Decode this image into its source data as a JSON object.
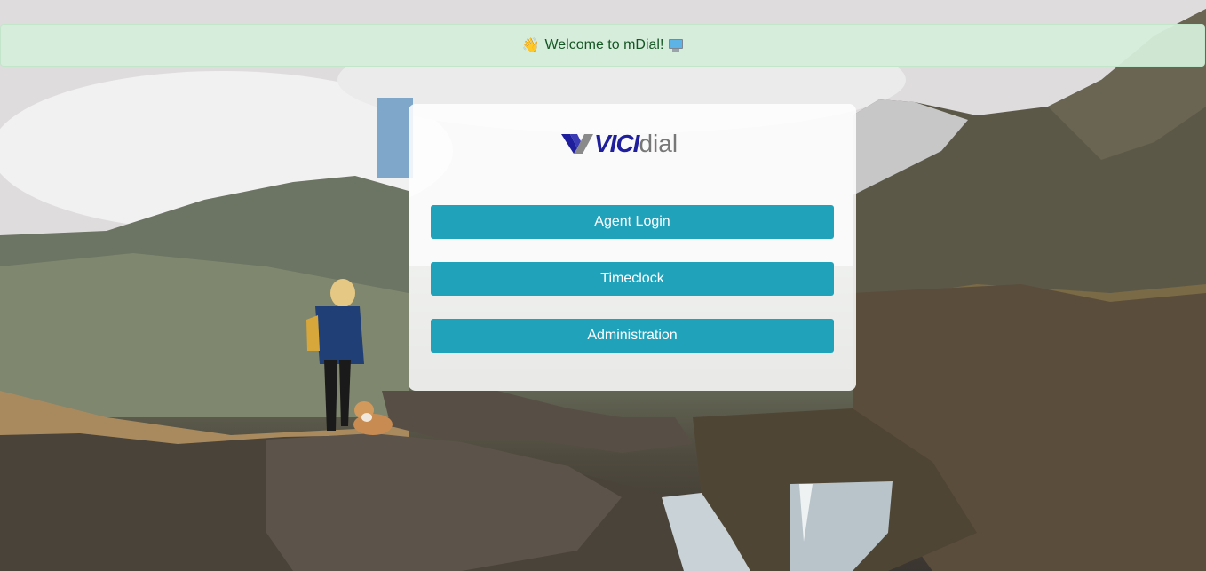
{
  "banner": {
    "text": "Welcome to mDial!",
    "wave_emoji": "👋",
    "icon": "computer-icon"
  },
  "logo": {
    "vici": "VICI",
    "dial": "dial"
  },
  "buttons": {
    "agent_login": "Agent Login",
    "timeclock": "Timeclock",
    "administration": "Administration"
  },
  "colors": {
    "banner_bg": "#d4edda",
    "banner_text": "#155724",
    "button_bg": "#21a2bb",
    "logo_blue": "#1f1f9e",
    "logo_gray": "#777777"
  },
  "background": {
    "description_icon": "landscape-photo"
  }
}
